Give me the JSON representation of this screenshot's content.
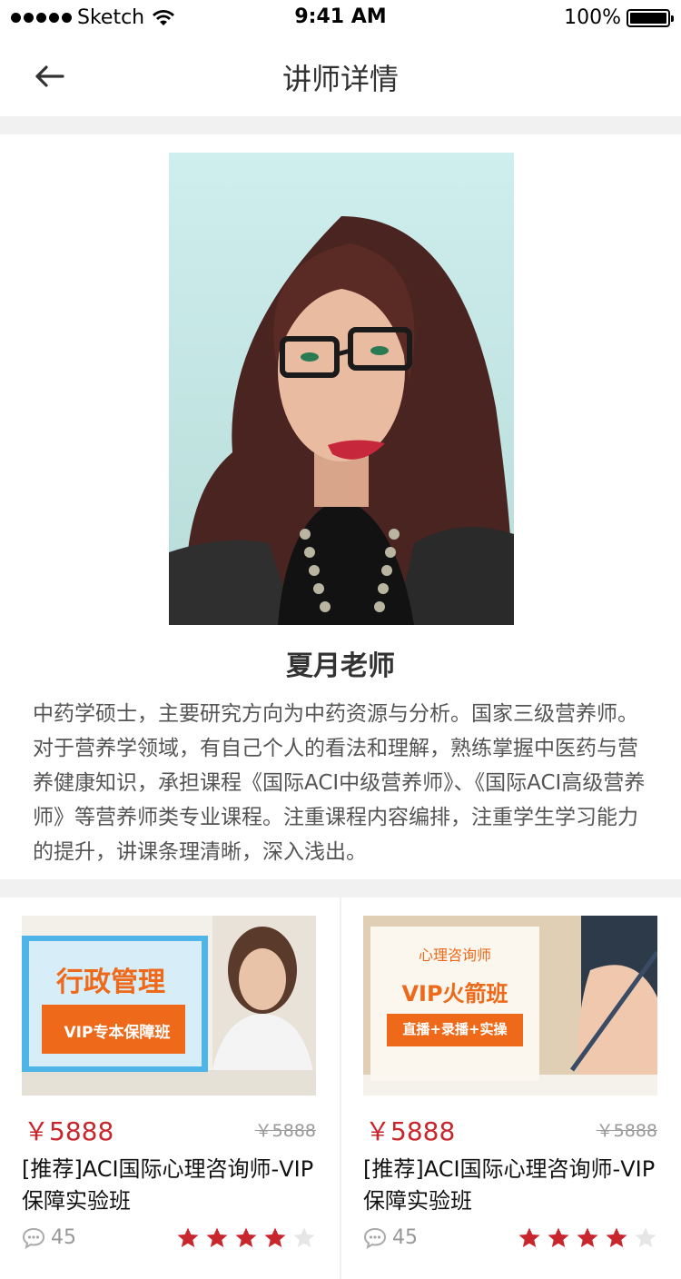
{
  "status_bar": {
    "carrier": "Sketch",
    "time": "9:41 AM",
    "battery": "100%"
  },
  "nav": {
    "title": "讲师详情"
  },
  "teacher": {
    "name": "夏月老师",
    "bio": "中药学硕士，主要研究方向为中药资源与分析。国家三级营养师。对于营养学领域，有自己个人的看法和理解，熟练掌握中医药与营养健康知识，承担课程《国际ACI中级营养师》、《国际ACI高级营养师》等营养师类专业课程。注重课程内容编排，注重学生学习能力的提升，讲课条理清晰，深入浅出。"
  },
  "courses": [
    {
      "thumb_title": "行政管理",
      "thumb_subtitle": "VIP专本保障班",
      "price": "￥5888",
      "old_price": "￥5888",
      "title": "[推荐]ACI国际心理咨询师-VIP保障实验班",
      "comments": "45",
      "rating": 4,
      "rating_max": 5
    },
    {
      "thumb_label": "心理咨询师",
      "thumb_title": "VIP火箭班",
      "thumb_subtitle": "直播+录播+实操",
      "price": "￥5888",
      "old_price": "￥5888",
      "title": "[推荐]ACI国际心理咨询师-VIP保障实验班",
      "comments": "45",
      "rating": 4,
      "rating_max": 5
    }
  ],
  "colors": {
    "price": "#c9252c",
    "star_on": "#c9252c",
    "star_off": "#e6e6e6",
    "thumb_orange": "#ee6a1a",
    "thumb_blue": "#3aa7e0"
  }
}
